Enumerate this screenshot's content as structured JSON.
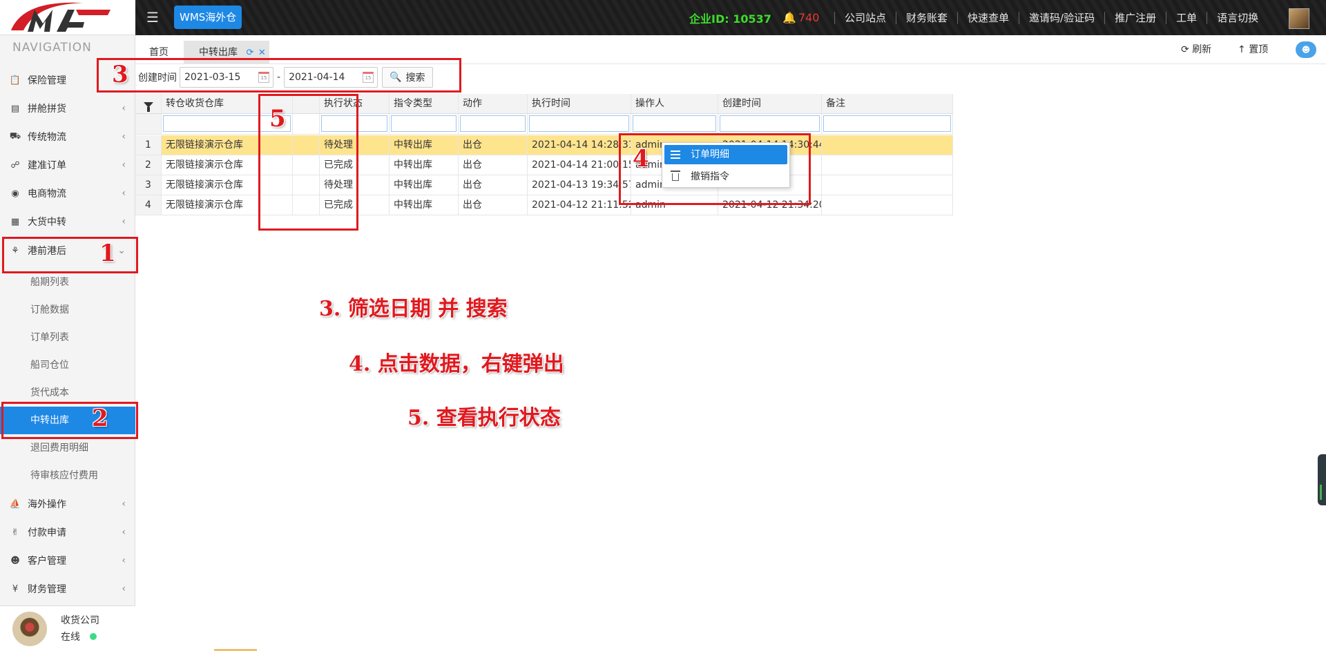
{
  "header": {
    "wms_label": "WMS海外仓",
    "company_id_label": "企业ID: 10537",
    "alert_count": "740",
    "nav_items": [
      "公司站点",
      "财务账套",
      "快速查单",
      "邀请码/验证码",
      "推广注册",
      "工单",
      "语言切换"
    ]
  },
  "sidebar": {
    "nav_title": "NAVIGATION",
    "menu": [
      {
        "label": "保险管理",
        "icon": "clipboard-icon",
        "has_arrow": false
      },
      {
        "label": "拼舱拼货",
        "icon": "boxes-icon",
        "has_arrow": true
      },
      {
        "label": "传统物流",
        "icon": "truck-icon",
        "has_arrow": true
      },
      {
        "label": "建准订单",
        "icon": "link-icon",
        "has_arrow": true
      },
      {
        "label": "电商物流",
        "icon": "globe-icon",
        "has_arrow": true
      },
      {
        "label": "大货中转",
        "icon": "grid-icon",
        "has_arrow": true
      },
      {
        "label": "港前港后",
        "icon": "cubes-icon",
        "has_arrow": true,
        "expanded": true
      }
    ],
    "submenu": [
      "船期列表",
      "订舱数据",
      "订单列表",
      "船司仓位",
      "货代成本",
      "中转出库",
      "退回费用明细",
      "待审核应付费用"
    ],
    "active_sub": "中转出库",
    "menu_after": [
      {
        "label": "海外操作",
        "icon": "ship-icon"
      },
      {
        "label": "付款申请",
        "icon": "handshake-icon"
      },
      {
        "label": "客户管理",
        "icon": "users-icon"
      },
      {
        "label": "财务管理",
        "icon": "yen-icon"
      }
    ],
    "user": {
      "name": "收货公司",
      "status": "在线"
    }
  },
  "tabs": {
    "home": "首页",
    "active": "中转出库",
    "refresh_label": "刷新",
    "top_label": "置顶"
  },
  "filter": {
    "label": "创建时间",
    "date_from": "2021-03-15",
    "date_to": "2021-04-14",
    "separator": "-",
    "search_label": "搜索"
  },
  "grid": {
    "columns": [
      "转仓收货仓库",
      "",
      "执行状态",
      "指令类型",
      "动作",
      "执行时间",
      "操作人",
      "创建时间",
      "备注"
    ],
    "rows": [
      {
        "num": "1",
        "warehouse": "无限链接演示仓库",
        "status": "待处理",
        "type": "中转出库",
        "action": "出仓",
        "exec_time": "2021-04-14 14:28:31",
        "operator": "admin",
        "created": "2021-04-14 14:30:44",
        "note": ""
      },
      {
        "num": "2",
        "warehouse": "无限链接演示仓库",
        "status": "已完成",
        "type": "中转出库",
        "action": "出仓",
        "exec_time": "2021-04-14 21:00:15",
        "operator": "admin",
        "created": "",
        "note": ""
      },
      {
        "num": "3",
        "warehouse": "无限链接演示仓库",
        "status": "待处理",
        "type": "中转出库",
        "action": "出仓",
        "exec_time": "2021-04-13 19:34:57",
        "operator": "admin",
        "created": "",
        "note": ""
      },
      {
        "num": "4",
        "warehouse": "无限链接演示仓库",
        "status": "已完成",
        "type": "中转出库",
        "action": "出仓",
        "exec_time": "2021-04-12 21:11:52",
        "operator": "admin",
        "created": "2021-04-12 21:34:20",
        "note": ""
      }
    ]
  },
  "context_menu": {
    "items": [
      "订单明细",
      "撤销指令"
    ]
  },
  "annotations": {
    "num1": "1",
    "num2": "2",
    "num3": "3",
    "num4": "4",
    "num5": "5",
    "text3": "3. 筛选日期  并  搜索",
    "text4": "4. 点击数据，右键弹出",
    "text5": "5. 查看执行状态",
    "color": "#e0191f"
  },
  "colors": {
    "accent": "#1e88e5",
    "selected_row": "#ffe48e",
    "company_id": "#3ddc2a",
    "alert": "#e53935"
  }
}
